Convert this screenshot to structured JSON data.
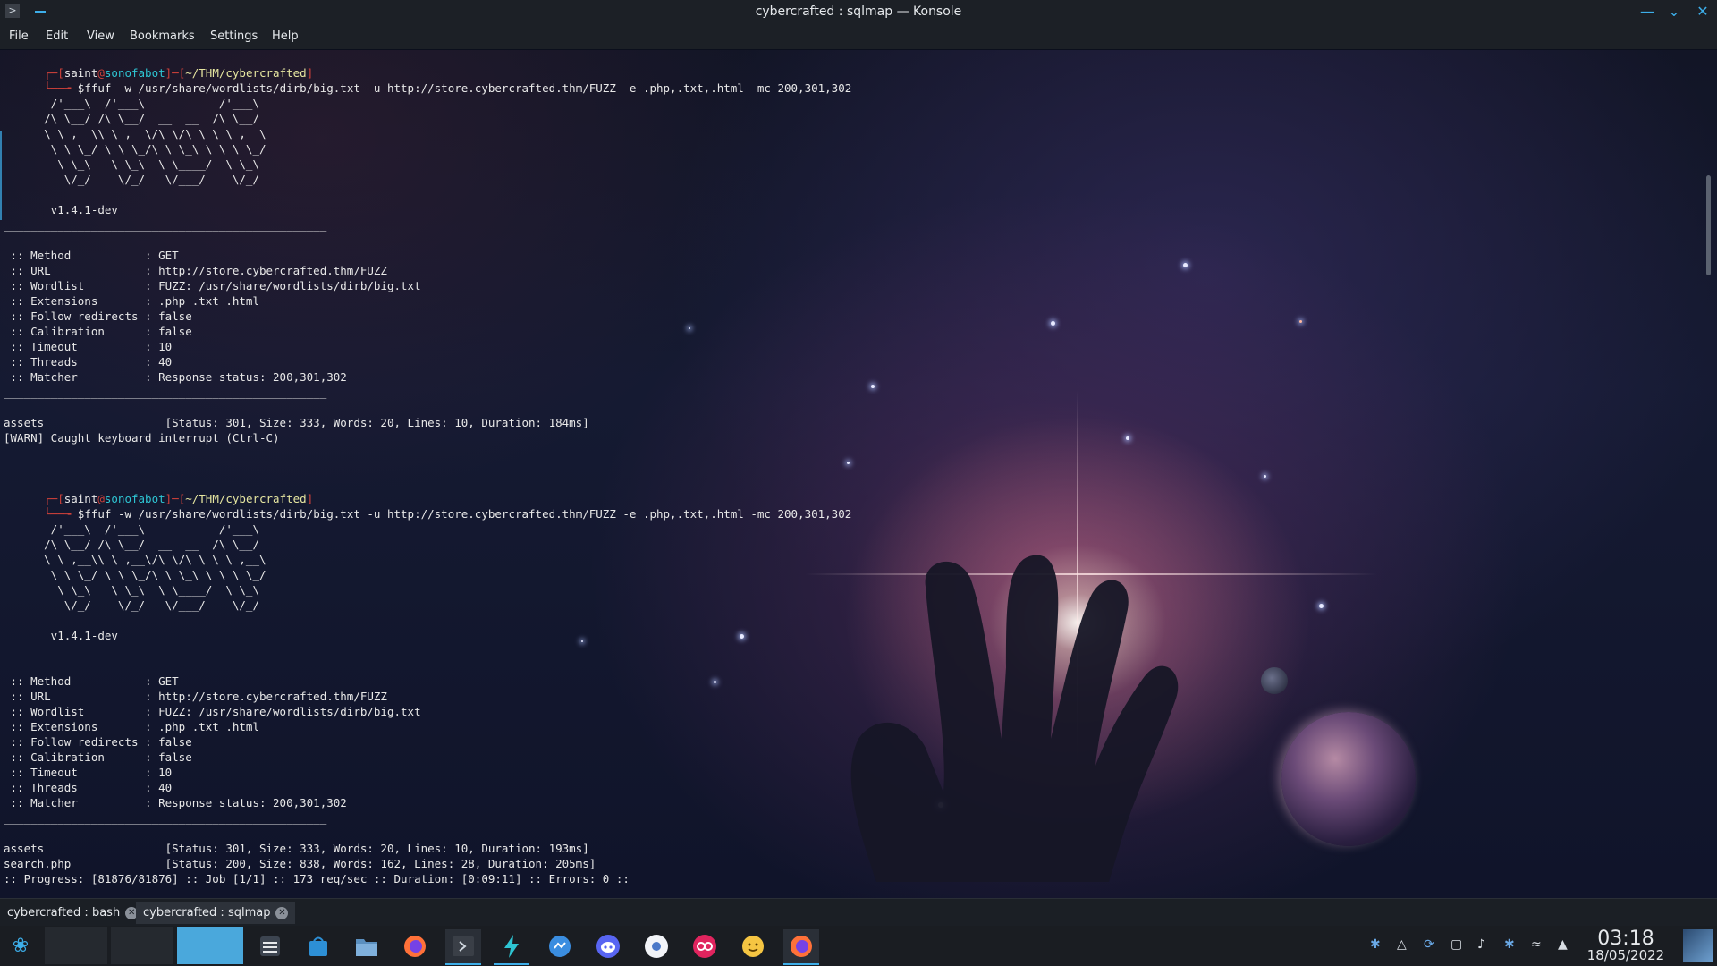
{
  "window": {
    "title": "cybercrafted : sqlmap — Konsole"
  },
  "menu": [
    "File",
    "Edit",
    "View",
    "Bookmarks",
    "Settings",
    "Help"
  ],
  "terminal": {
    "prompt1": {
      "open": "┌─[",
      "user": "saint",
      "at": "@",
      "host": "sonofabot",
      "mid": "]─[",
      "path": "~/THM/cybercrafted",
      "close": "]"
    },
    "cmd1": {
      "arrow": "└──╼ ",
      "text": "$ffuf -w /usr/share/wordlists/dirb/big.txt -u http://store.cybercrafted.thm/FUZZ -e .php,.txt,.html -mc 200,301,302"
    },
    "banner": [
      "       /'___\\  /'___\\           /'___\\       ",
      "      /\\ \\__/ /\\ \\__/  __  __  /\\ \\__/       ",
      "      \\ \\ ,__\\\\ \\ ,__\\/\\ \\/\\ \\ \\ \\ ,__\\      ",
      "       \\ \\ \\_/ \\ \\ \\_/\\ \\ \\_\\ \\ \\ \\ \\_/      ",
      "        \\ \\_\\   \\ \\_\\  \\ \\____/  \\ \\_\\       ",
      "         \\/_/    \\/_/   \\/___/    \\/_/       "
    ],
    "version": "       v1.4.1-dev",
    "separator": "________________________________________________",
    "config": [
      " :: Method           : GET",
      " :: URL              : http://store.cybercrafted.thm/FUZZ",
      " :: Wordlist         : FUZZ: /usr/share/wordlists/dirb/big.txt",
      " :: Extensions       : .php .txt .html",
      " :: Follow redirects : false",
      " :: Calibration      : false",
      " :: Timeout          : 10",
      " :: Threads          : 40",
      " :: Matcher          : Response status: 200,301,302"
    ],
    "run1_results": [
      "assets                  [Status: 301, Size: 333, Words: 20, Lines: 10, Duration: 184ms]",
      "[WARN] Caught keyboard interrupt (Ctrl-C)"
    ],
    "prompt2": {
      "open": "┌─[",
      "user": "saint",
      "at": "@",
      "host": "sonofabot",
      "mid": "]─[",
      "path": "~/THM/cybercrafted",
      "close": "]"
    },
    "cmd2": {
      "arrow": "└──╼ ",
      "text": "$ffuf -w /usr/share/wordlists/dirb/big.txt -u http://store.cybercrafted.thm/FUZZ -e .php,.txt,.html -mc 200,301,302"
    },
    "run2_results": [
      "assets                  [Status: 301, Size: 333, Words: 20, Lines: 10, Duration: 193ms]",
      "search.php              [Status: 200, Size: 838, Words: 162, Lines: 28, Duration: 205ms]",
      ":: Progress: [81876/81876] :: Job [1/1] :: 173 req/sec :: Duration: [0:09:11] :: Errors: 0 ::"
    ]
  },
  "tabs": [
    {
      "label": "cybercrafted : bash",
      "active": false
    },
    {
      "label": "cybercrafted : sqlmap",
      "active": true
    }
  ],
  "panel": {
    "clock_time": "03:18",
    "clock_date": "18/05/2022",
    "tasks": [
      "system-settings-icon",
      "store-icon",
      "file-manager-icon",
      "firefox-icon",
      "konsole-icon",
      "bolt-app-icon",
      "messenger-icon",
      "discord-icon",
      "sunflower-icon",
      "flickr-icon",
      "emoji-icon",
      "firefox-active-icon"
    ],
    "tray": [
      "bluetooth-icon",
      "notifications-icon",
      "sync-icon",
      "clipboard-icon",
      "volume-icon",
      "bluetooth-status-icon",
      "wifi-icon",
      "tray-expand-icon"
    ]
  },
  "colors": {
    "accent": "#3daee9",
    "prompt_bracket": "#d0413a",
    "prompt_host": "#2ec5d3",
    "prompt_path": "#e6e6a0",
    "panel_bg": "#1a1d22"
  }
}
